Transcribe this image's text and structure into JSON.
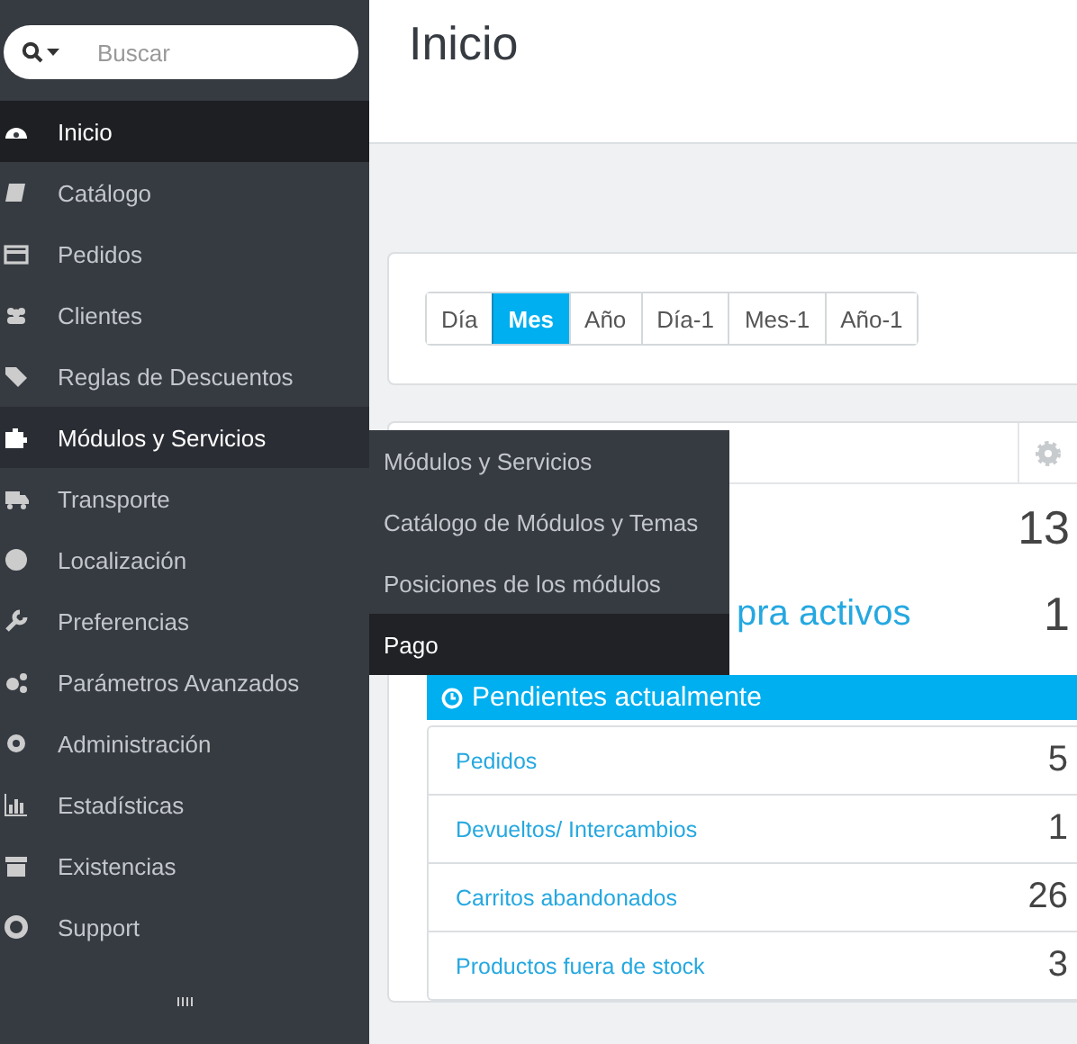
{
  "search": {
    "placeholder": "Buscar"
  },
  "sidebar": {
    "items": [
      {
        "label": "Inicio",
        "selected": true,
        "expanded": false
      },
      {
        "label": "Catálogo",
        "selected": false,
        "expanded": false
      },
      {
        "label": "Pedidos",
        "selected": false,
        "expanded": false
      },
      {
        "label": "Clientes",
        "selected": false,
        "expanded": false
      },
      {
        "label": "Reglas de Descuentos",
        "selected": false,
        "expanded": false
      },
      {
        "label": "Módulos y Servicios",
        "selected": false,
        "expanded": true
      },
      {
        "label": "Transporte",
        "selected": false,
        "expanded": false
      },
      {
        "label": "Localización",
        "selected": false,
        "expanded": false
      },
      {
        "label": "Preferencias",
        "selected": false,
        "expanded": false
      },
      {
        "label": "Parámetros Avanzados",
        "selected": false,
        "expanded": false
      },
      {
        "label": "Administración",
        "selected": false,
        "expanded": false
      },
      {
        "label": "Estadísticas",
        "selected": false,
        "expanded": false
      },
      {
        "label": "Existencias",
        "selected": false,
        "expanded": false
      },
      {
        "label": "Support",
        "selected": false,
        "expanded": false
      }
    ]
  },
  "submenu": {
    "items": [
      {
        "label": "Módulos y Servicios",
        "selected": false
      },
      {
        "label": "Catálogo de Módulos y Temas",
        "selected": false
      },
      {
        "label": "Posiciones de los módulos",
        "selected": false
      },
      {
        "label": "Pago",
        "selected": true
      }
    ]
  },
  "page_title": "Inicio",
  "periods": [
    {
      "label": "Día",
      "selected": false
    },
    {
      "label": "Mes",
      "selected": true
    },
    {
      "label": "Año",
      "selected": false
    },
    {
      "label": "Día-1",
      "selected": false
    },
    {
      "label": "Mes-1",
      "selected": false
    },
    {
      "label": "Año-1",
      "selected": false
    }
  ],
  "activity": {
    "rows": [
      {
        "label": "",
        "value": "13"
      },
      {
        "label": "pra activos",
        "value": "1"
      }
    ],
    "pending": {
      "title": "Pendientes actualmente",
      "rows": [
        {
          "label": "Pedidos",
          "value": "5"
        },
        {
          "label": "Devueltos/ Intercambios",
          "value": "1"
        },
        {
          "label": "Carritos abandonados",
          "value": "26"
        },
        {
          "label": "Productos fuera de stock",
          "value": "3"
        }
      ]
    }
  }
}
